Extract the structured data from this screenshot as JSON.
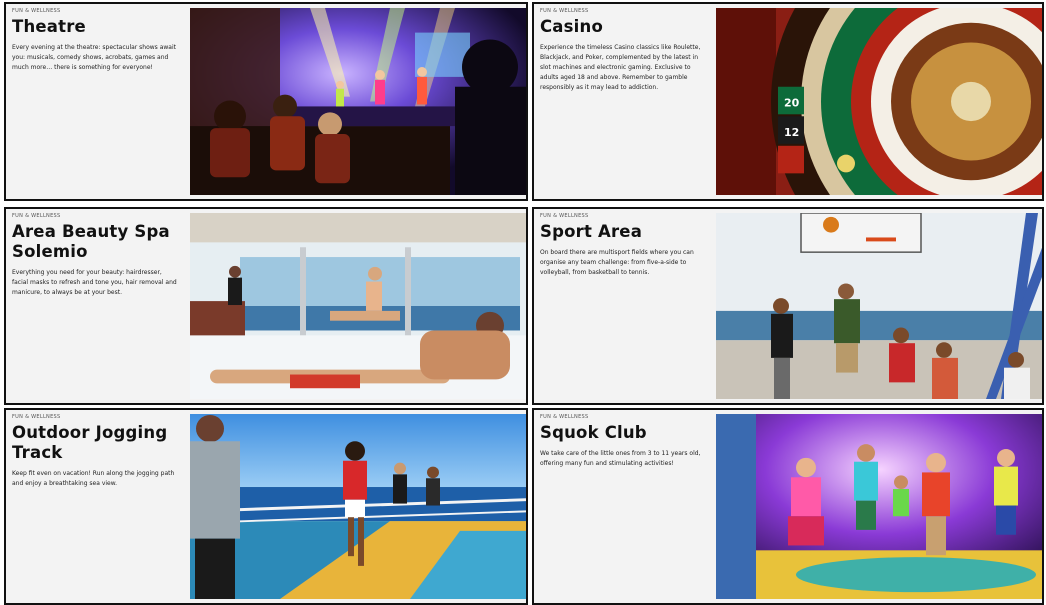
{
  "cards": [
    {
      "eyebrow": "FUN & WELLNESS",
      "title": "Theatre",
      "description": "Every evening at the theatre: spectacular shows await you: musicals, comedy shows, acrobats, games and much more… there is something for everyone!",
      "image": "theatre-stage-photo"
    },
    {
      "eyebrow": "FUN & WELLNESS",
      "title": "Casino",
      "description": "Experience the timeless Casino classics like Roulette, Blackjack, and Poker, complemented by the latest in slot machines and electronic gaming. Exclusive to adults aged 18 and above. Remember to gamble responsibly as it may lead to addiction.",
      "image": "roulette-wheel-photo",
      "wheel_numbers": [
        "20",
        "12"
      ]
    },
    {
      "eyebrow": "FUN & WELLNESS",
      "title": "Area Beauty Spa Solemio",
      "description": "Everything you need for your beauty: hairdresser, facial masks to refresh and tone you, hair removal and manicure, to always be at your best.",
      "image": "spa-pool-photo"
    },
    {
      "eyebrow": "FUN & WELLNESS",
      "title": "Sport Area",
      "description": "On board there are multisport fields where you can organise any team challenge: from five-a-side to volleyball, from basketball to tennis.",
      "image": "basketball-deck-photo"
    },
    {
      "eyebrow": "FUN & WELLNESS",
      "title": "Outdoor Jogging Track",
      "description": "Keep fit even on vacation! Run along the jogging path and enjoy a breathtaking sea view.",
      "image": "jogging-track-photo"
    },
    {
      "eyebrow": "FUN & WELLNESS",
      "title": "Squok Club",
      "description": "We take care of the little ones from 3 to 11 years old, offering many fun and stimulating activities!",
      "image": "kids-club-photo"
    }
  ]
}
